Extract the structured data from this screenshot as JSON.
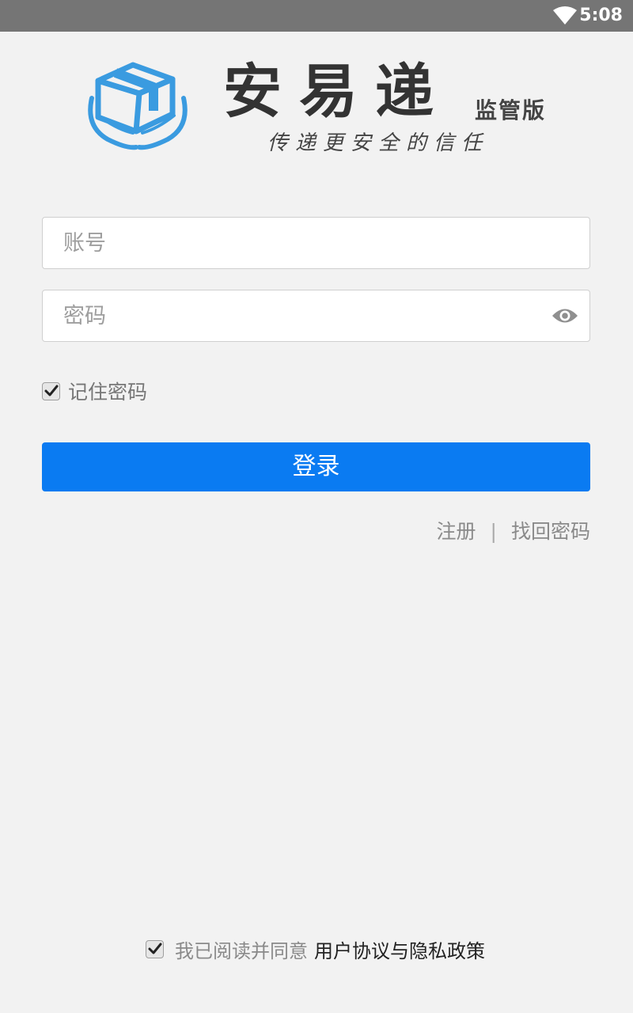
{
  "status_bar": {
    "time": "5:08"
  },
  "header": {
    "app_name": "安易递",
    "edition": "监管版",
    "slogan": "传递更安全的信任"
  },
  "form": {
    "account_placeholder": "账号",
    "account_value": "",
    "password_placeholder": "密码",
    "password_value": "",
    "remember_label": "记住密码",
    "remember_checked": true,
    "login_label": "登录"
  },
  "links": {
    "register": "注册",
    "separator": "|",
    "forgot": "找回密码"
  },
  "footer": {
    "agree_checked": true,
    "agree_text": "我已阅读并同意",
    "agreement_link": "用户协议与隐私政策"
  },
  "colors": {
    "primary": "#0a7bf2",
    "logo_blue": "#3a9be0",
    "status_bar": "#757575",
    "background": "#f2f2f2"
  }
}
